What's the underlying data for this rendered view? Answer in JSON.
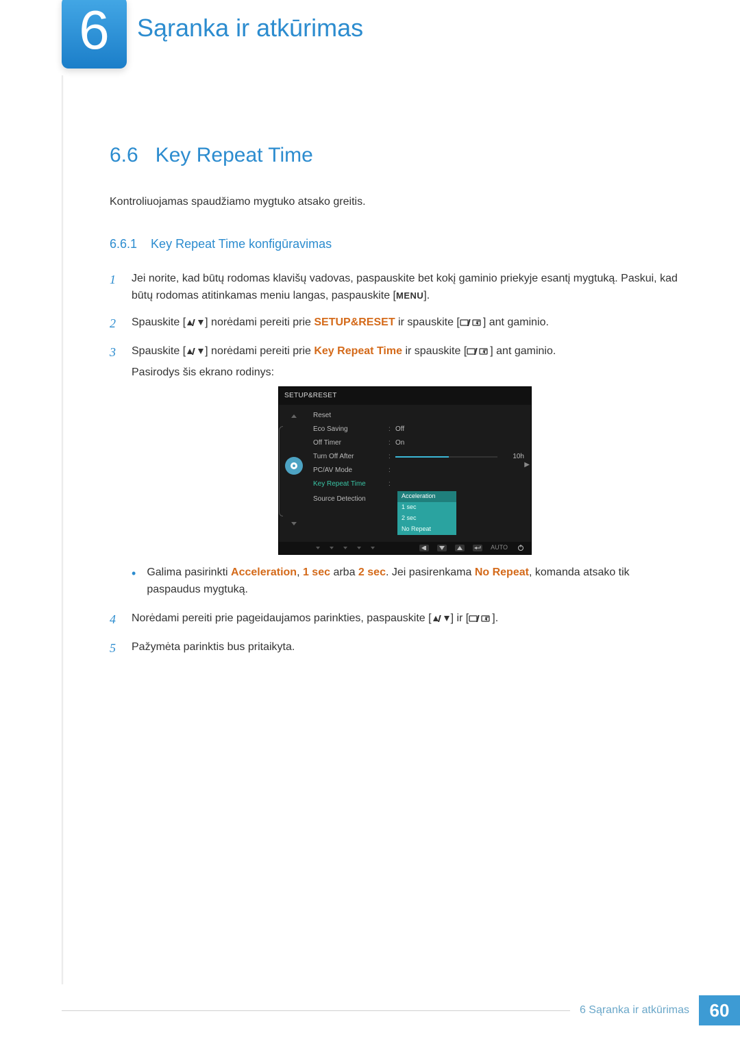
{
  "chapter": {
    "num": "6",
    "title": "Sąranka ir atkūrimas"
  },
  "section": {
    "num": "6.6",
    "title": "Key Repeat Time"
  },
  "intro": "Kontroliuojamas spaudžiamo mygtuko atsako greitis.",
  "subsection": {
    "num": "6.6.1",
    "title": "Key Repeat Time konfigūravimas"
  },
  "steps": {
    "s1": {
      "num": "1",
      "a": "Jei norite, kad būtų rodomas klavišų vadovas, paspauskite bet kokį gaminio priekyje esantį mygtuką. Paskui, kad būtų rodomas atitinkamas meniu langas, paspauskite [",
      "menu": "MENU",
      "b": "]."
    },
    "s2": {
      "num": "2",
      "a": "Spauskite [",
      "b": "] norėdami pereiti prie ",
      "kw": "SETUP&RESET",
      "c": " ir spauskite [",
      "d": "] ant gaminio."
    },
    "s3": {
      "num": "3",
      "a": "Spauskite [",
      "b": "] norėdami pereiti prie ",
      "kw": "Key Repeat Time",
      "c": " ir spauskite [",
      "d": "] ant gaminio.",
      "e": "Pasirodys šis ekrano rodinys:"
    },
    "bullet": {
      "a": "Galima pasirinkti ",
      "k1": "Acceleration",
      "sep1": ", ",
      "k2": "1 sec",
      "mid": " arba ",
      "k3": "2 sec",
      "b": ". Jei pasirenkama ",
      "k4": "No Repeat",
      "c": ", komanda atsako tik paspaudus mygtuką."
    },
    "s4": {
      "num": "4",
      "a": "Norėdami pereiti prie pageidaujamos parinkties, paspauskite [",
      "b": "] ir [",
      "c": "]."
    },
    "s5": {
      "num": "5",
      "a": "Pažymėta parinktis bus pritaikyta."
    }
  },
  "osd": {
    "title": "SETUP&RESET",
    "rows": {
      "reset": "Reset",
      "eco": "Eco Saving",
      "eco_val": "Off",
      "timer": "Off Timer",
      "timer_val": "On",
      "turnoff": "Turn Off After",
      "turnoff_val": "10h",
      "pcav": "PC/AV Mode",
      "krt": "Key Repeat Time",
      "srcdet": "Source Detection"
    },
    "popup": {
      "p1": "Acceleration",
      "p2": "1 sec",
      "p3": "2 sec",
      "p4": "No Repeat"
    },
    "auto": "AUTO"
  },
  "footer": {
    "text": "6 Sąranka ir atkūrimas",
    "page": "60"
  }
}
